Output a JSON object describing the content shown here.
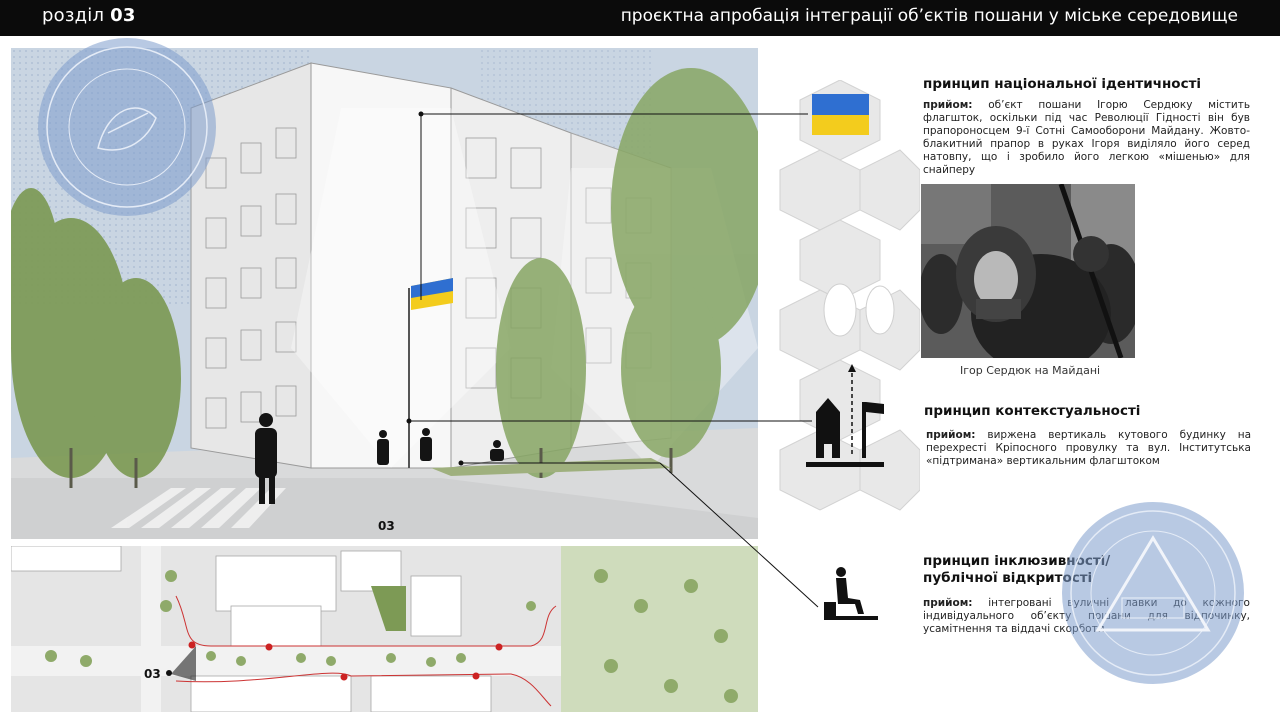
{
  "header": {
    "section_word": "розділ",
    "section_number": "03",
    "title": "проєктна апробація інтеграції об’єктів пошани у міське середовище"
  },
  "views": {
    "render_tag": "03",
    "plan_tag": "03"
  },
  "principles": [
    {
      "heading": "принцип національної ідентичності",
      "technique_label": "прийом:",
      "text": "об’єкт пошани Ігорю Сердюку містить флагшток, оскільки під час Революції Гідності він був прапороносцем 9-ї Сотні Самооборони Майдану. Жовто-блакитний прапор в руках Ігоря виділяло його серед натовпу, що і зробило його легкою «мішенью» для снайперу",
      "icon": "ukraine-flag-icon"
    },
    {
      "heading": "принцип контекстуальності",
      "technique_label": "прийом:",
      "text": "виржена вертикаль кутового будинку на перехресті Кріпосного провулку та вул. Інститутська «підтримана» вертикальним флагштоком",
      "icon": "building-flagpole-icon"
    },
    {
      "heading_line1": "принцип інклюзивності/",
      "heading_line2": "публічної відкритості",
      "technique_label": "прийом:",
      "text": "інтегровані вуличні лавки до кожного індивідуального об’єкту пошани для відпочинку, усамітнення та віддачі скорботи",
      "icon": "seated-person-bench-icon"
    }
  ],
  "photo": {
    "caption": "Ігор Сердюк на Майдані"
  },
  "colors": {
    "flag_blue": "#2f6fd1",
    "flag_yellow": "#f3cc1d",
    "seal_blue": "#7e9ccc",
    "topbar": "#0b0b0b"
  }
}
